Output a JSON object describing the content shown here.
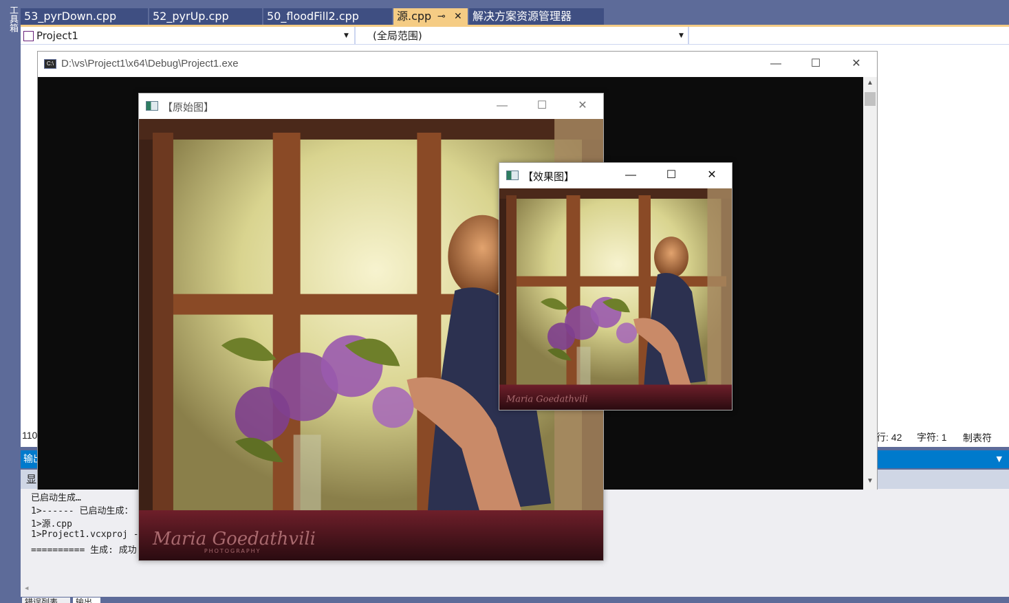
{
  "shell": {
    "toolbox_label": "工具箱",
    "tabs": [
      {
        "label": "53_pyrDown.cpp"
      },
      {
        "label": "52_pyrUp.cpp"
      },
      {
        "label": "50_floodFill2.cpp"
      },
      {
        "label": "源.cpp",
        "pin": "⊸",
        "close": "✕"
      },
      {
        "label": "解决方案资源管理器"
      }
    ],
    "nav": {
      "project": "Project1",
      "scope": "(全局范围)",
      "arrow": "▼"
    },
    "status": {
      "line_partial": "110",
      "col": "行: 42",
      "char": "字符: 1",
      "tab_mode": "制表符"
    },
    "output": {
      "header": "输出",
      "show_label": "显",
      "lines": [
        "已启动生成…",
        "1>------ 已启动生成：",
        "1>源.cpp",
        "1>Project1.vcxproj -",
        "========== 生成: 成功"
      ]
    },
    "bottom_tabs": [
      "错误列表",
      "输出"
    ]
  },
  "console": {
    "title": "D:\\vs\\Project1\\x64\\Debug\\Project1.exe",
    "icon": "C:\\",
    "buttons": {
      "minimize": "—",
      "maximize": "☐",
      "close": "✕"
    },
    "scroll_up": "▲",
    "scroll_down": "▼"
  },
  "windows": {
    "original": {
      "title": "【原始图】",
      "buttons": {
        "minimize": "—",
        "maximize": "☐",
        "close": "✕"
      },
      "watermark": "Maria Goedathvili",
      "watermark_sub": "PHOTOGRAPHY"
    },
    "effect": {
      "title": "【效果图】",
      "buttons": {
        "minimize": "—",
        "maximize": "☐",
        "close": "✕"
      },
      "watermark": "Maria Goedathvili"
    }
  }
}
